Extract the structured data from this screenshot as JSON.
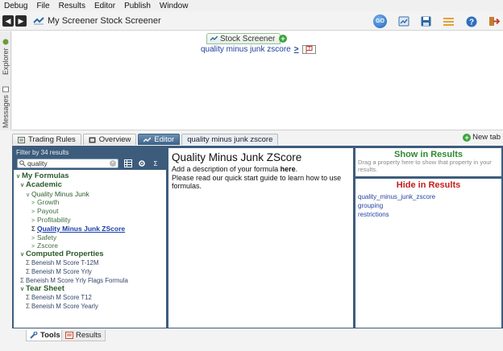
{
  "menubar": {
    "items": [
      "Debug",
      "File",
      "Results",
      "Editor",
      "Publish",
      "Window"
    ]
  },
  "toolbar": {
    "back_icon": "back-arrow-icon",
    "forward_icon": "forward-arrow-icon",
    "breadcrumb": "My Screener Stock Screener",
    "go_label": "GO",
    "icons": [
      "go-icon",
      "chart-icon",
      "save-icon",
      "list-icon",
      "help-icon",
      "exit-icon"
    ]
  },
  "sidedock": {
    "explorer_label": "Explorer",
    "messages_label": "Messages"
  },
  "canvas": {
    "screener_tab_label": "Stock Screener",
    "rule": {
      "lhs": "quality minus junk zscore",
      "operator": ">",
      "value": "?"
    }
  },
  "tabs": [
    {
      "label": "Trading Rules",
      "icon": "rules-icon"
    },
    {
      "label": "Overview",
      "icon": "overview-icon"
    },
    {
      "label": "Editor",
      "icon": "editor-icon"
    },
    {
      "label": "quality minus junk zscore",
      "icon": ""
    }
  ],
  "new_tab_label": "New tab",
  "left_panel": {
    "filter_header": "Filter by 34 results",
    "search_value": "quality",
    "tree": [
      {
        "label": "My Formulas",
        "kind": "hdr",
        "indent": 0,
        "marker": "v"
      },
      {
        "label": "Academic",
        "kind": "hdr",
        "indent": 1,
        "marker": "v"
      },
      {
        "label": "Quality Minus Junk",
        "kind": "fold",
        "indent": 2,
        "marker": "v"
      },
      {
        "label": "Growth",
        "kind": "item",
        "indent": 3,
        "marker": ">"
      },
      {
        "label": "Payout",
        "kind": "item",
        "indent": 3,
        "marker": ">"
      },
      {
        "label": "Profitability",
        "kind": "item",
        "indent": 3,
        "marker": ">"
      },
      {
        "label": "Quality Minus Junk ZScore",
        "kind": "link",
        "indent": 3,
        "marker": "Σ"
      },
      {
        "label": "Safety",
        "kind": "item",
        "indent": 3,
        "marker": ">"
      },
      {
        "label": "Zscore",
        "kind": "item",
        "indent": 3,
        "marker": ">"
      },
      {
        "label": "Computed Properties",
        "kind": "hdr",
        "indent": 1,
        "marker": "v"
      },
      {
        "label": "Beneish M Score T-12M",
        "kind": "formula",
        "indent": 2,
        "marker": "Σ"
      },
      {
        "label": "Beneish M Score Yrly",
        "kind": "formula",
        "indent": 2,
        "marker": "Σ"
      },
      {
        "label": "Beneish M Score Yrly Flags Formula",
        "kind": "formula",
        "indent": 1,
        "marker": "Σ"
      },
      {
        "label": "Tear Sheet",
        "kind": "hdr",
        "indent": 1,
        "marker": "v"
      },
      {
        "label": "Beneish M Score T12",
        "kind": "formula",
        "indent": 2,
        "marker": "Σ"
      },
      {
        "label": "Beneish M Score Yearly",
        "kind": "formula",
        "indent": 2,
        "marker": "Σ"
      }
    ]
  },
  "mid_panel": {
    "title": "Quality Minus Junk ZScore",
    "desc_line1_pre": "Add a description of your formula ",
    "desc_line1_bold": "here",
    "desc_line1_post": ".",
    "desc_line2": "Please read our quick start guide to learn how to use formulas."
  },
  "right_panel": {
    "show_header": "Show in Results",
    "show_hint": "Drag a property here to show that property in your results.",
    "hide_header": "Hide in Results",
    "hidden_props": [
      "quality_minus_junk_zscore",
      "grouping",
      "restrictions"
    ]
  },
  "bottom_tabs": [
    {
      "label": "Tools",
      "icon": "tools-icon"
    },
    {
      "label": "Results",
      "icon": "results-icon"
    }
  ]
}
